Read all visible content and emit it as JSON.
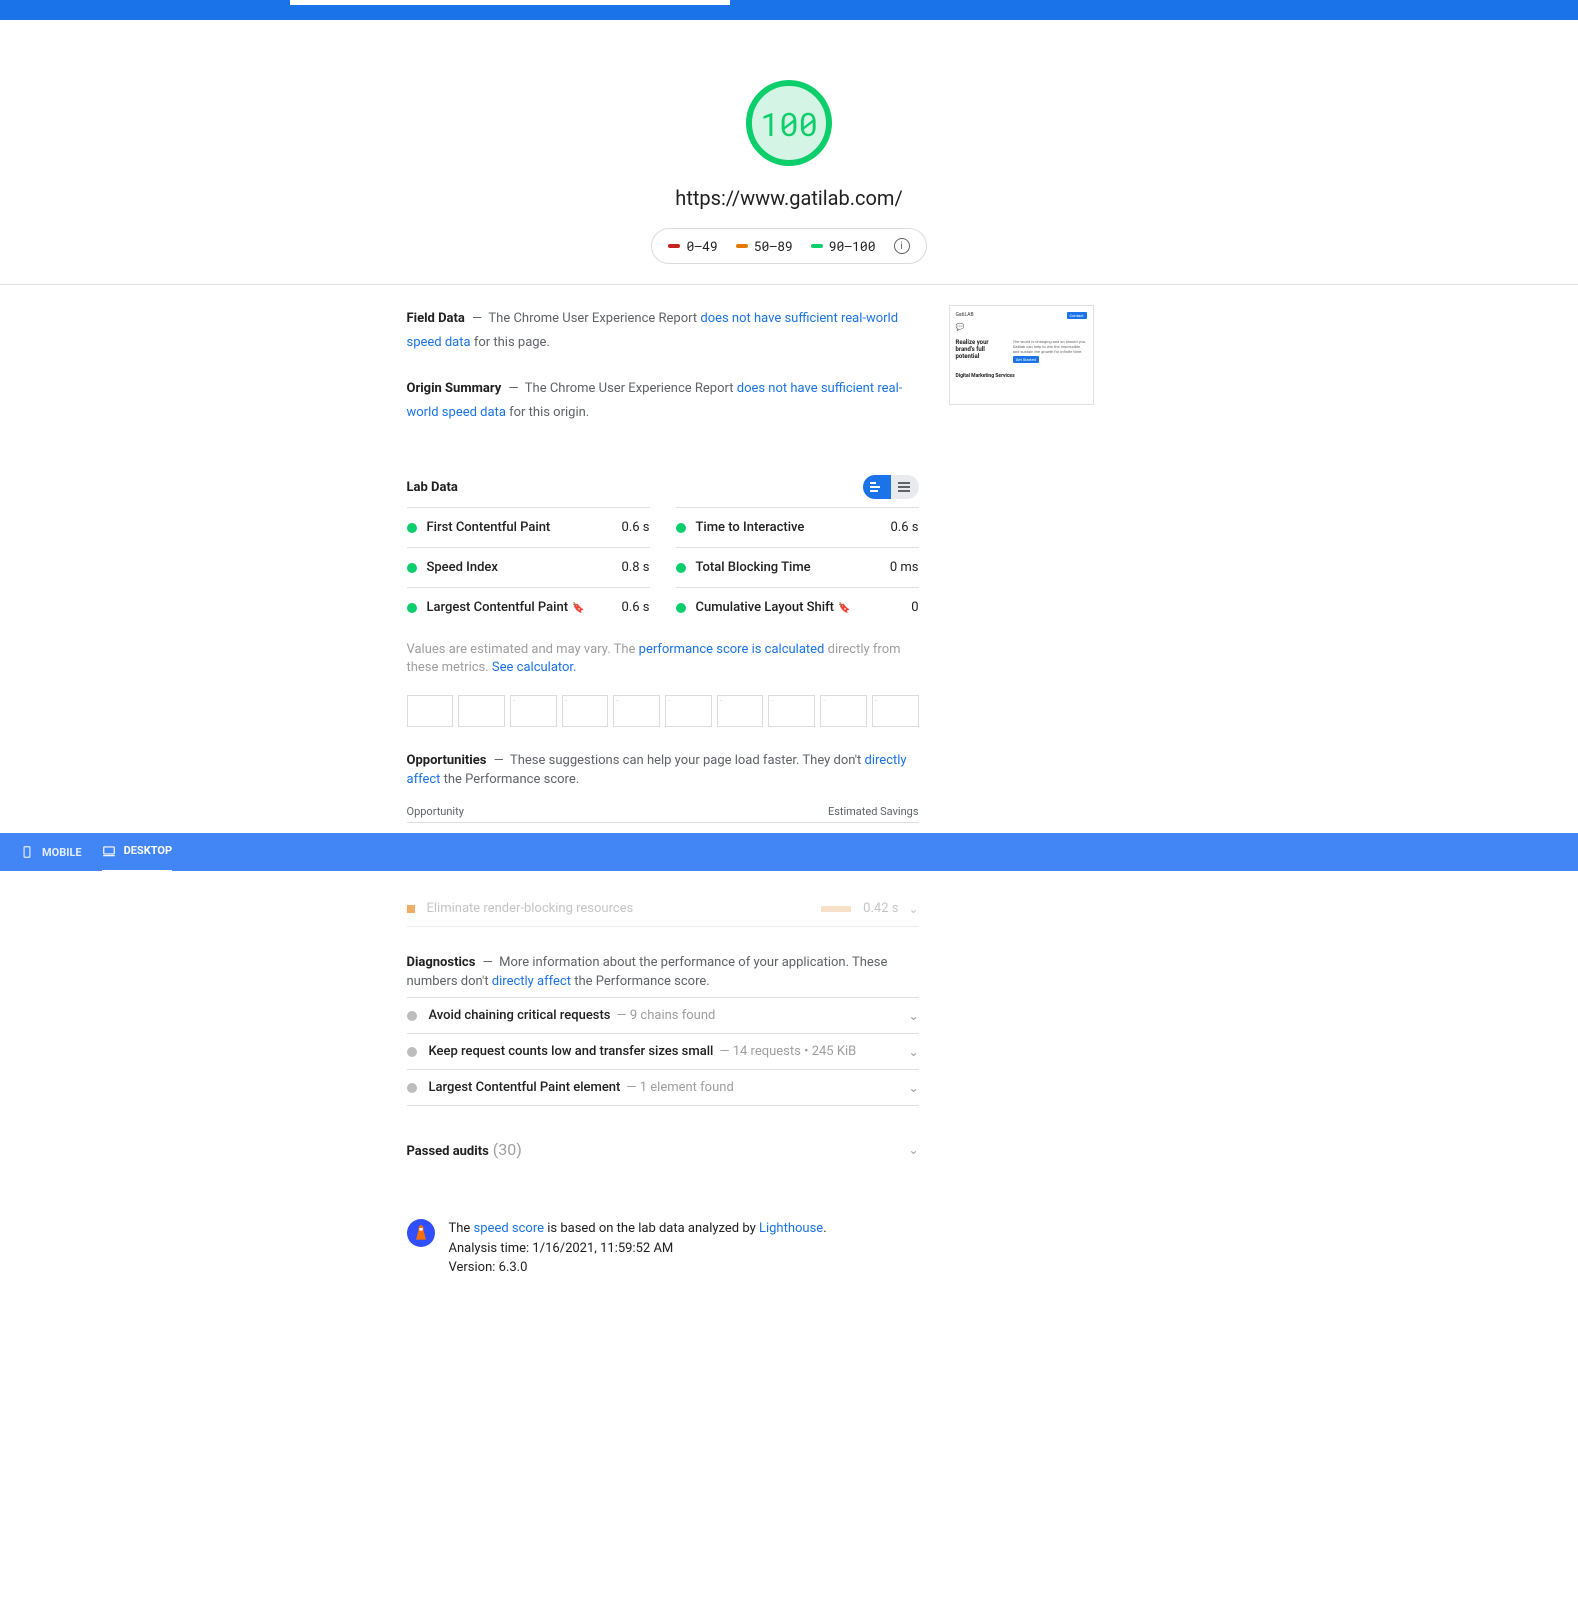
{
  "score": "100",
  "url": "https://www.gatilab.com/",
  "legend": {
    "low": "0–49",
    "mid": "50–89",
    "high": "90–100"
  },
  "fieldData": {
    "label": "Field Data",
    "prefix": "The Chrome User Experience Report ",
    "link": "does not have sufficient real-world speed data",
    "suffix": " for this page."
  },
  "originSummary": {
    "label": "Origin Summary",
    "prefix": "The Chrome User Experience Report ",
    "link": "does not have sufficient real-world speed data",
    "suffix": " for this origin."
  },
  "labData": {
    "label": "Lab Data"
  },
  "metrics": [
    {
      "name": "First Contentful Paint",
      "value": "0.6 s",
      "bookmark": false
    },
    {
      "name": "Time to Interactive",
      "value": "0.6 s",
      "bookmark": false
    },
    {
      "name": "Speed Index",
      "value": "0.8 s",
      "bookmark": false
    },
    {
      "name": "Total Blocking Time",
      "value": "0 ms",
      "bookmark": false
    },
    {
      "name": "Largest Contentful Paint",
      "value": "0.6 s",
      "bookmark": true
    },
    {
      "name": "Cumulative Layout Shift",
      "value": "0",
      "bookmark": true
    }
  ],
  "note": {
    "prefix": "Values are estimated and may vary. The ",
    "link1": "performance score is calculated",
    "mid": " directly from these metrics. ",
    "link2": "See calculator."
  },
  "opportunities": {
    "label": "Opportunities",
    "desc_prefix": "These suggestions can help your page load faster. They don't ",
    "desc_link": "directly affect",
    "desc_suffix": " the Performance score.",
    "col1": "Opportunity",
    "col2": "Estimated Savings",
    "items": [
      {
        "name": "Eliminate render-blocking resources",
        "value": "0.42 s"
      }
    ]
  },
  "tabs": {
    "mobile": "MOBILE",
    "desktop": "DESKTOP"
  },
  "diagnostics": {
    "label": "Diagnostics",
    "desc_prefix": "More information about the performance of your application. These numbers don't ",
    "desc_link": "directly affect",
    "desc_suffix": " the Performance score.",
    "items": [
      {
        "name": "Avoid chaining critical requests",
        "detail": "9 chains found"
      },
      {
        "name": "Keep request counts low and transfer sizes small",
        "detail": "14 requests • 245 KiB"
      },
      {
        "name": "Largest Contentful Paint element",
        "detail": "1 element found"
      }
    ]
  },
  "passed": {
    "label": "Passed audits",
    "count": "(30)"
  },
  "footer": {
    "line1_prefix": "The ",
    "line1_link1": "speed score",
    "line1_mid": " is based on the lab data analyzed by ",
    "line1_link2": "Lighthouse",
    "line1_suffix": ".",
    "line2": "Analysis time: 1/16/2021, 11:59:52 AM",
    "line3": "Version: 6.3.0"
  },
  "thumbnail": {
    "logo": "GatiLAB",
    "btn": "Contact",
    "headline": "Realize your brand's full potential",
    "section2": "Digital Marketing Services"
  }
}
